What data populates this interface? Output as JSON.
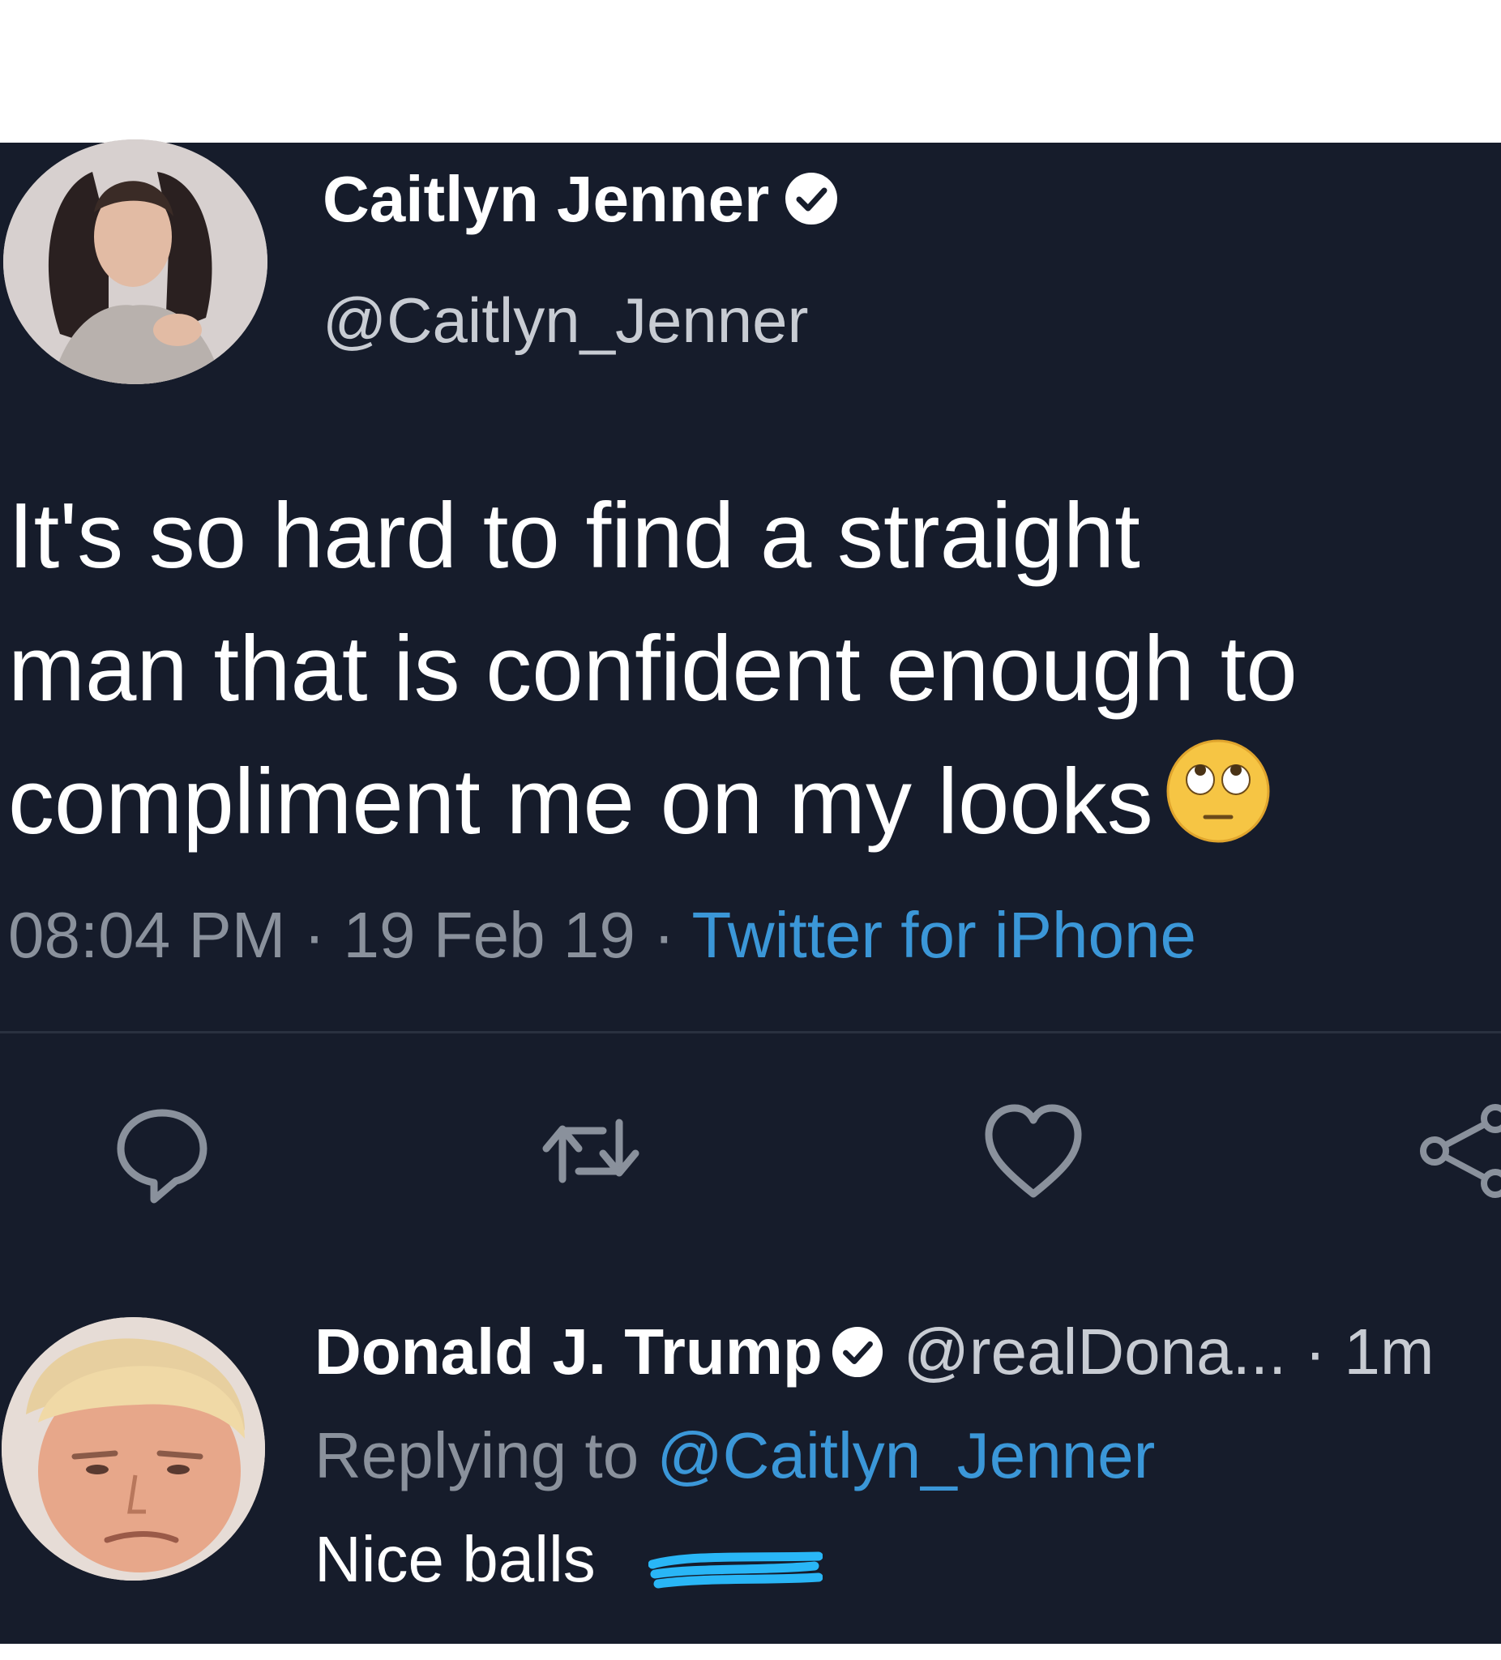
{
  "tweet": {
    "author_name": "Caitlyn Jenner",
    "author_handle": "@Caitlyn_Jenner",
    "verified_icon": "verified-badge-icon",
    "text_lines": [
      "It's so hard to find a straight",
      "man that is confident enough to",
      "compliment me on my looks"
    ],
    "emoji": "face-with-rolling-eyes",
    "time": "08:04 PM",
    "separator": "·",
    "date": "19 Feb 19",
    "source": "Twitter for iPhone"
  },
  "actions": {
    "icons": [
      "reply-icon",
      "retweet-icon",
      "like-icon",
      "share-icon"
    ]
  },
  "reply": {
    "author_name": "Donald J. Trump",
    "author_handle": "@realDona...",
    "age": "1m",
    "replying_prefix": "Replying to",
    "replying_handle": "@Caitlyn_Jenner",
    "text_visible": "Nice balls"
  },
  "colors": {
    "background": "#161c2b",
    "text": "#ffffff",
    "muted": "#8a919c",
    "link": "#3b97d8",
    "redaction": "#29b6f6"
  }
}
